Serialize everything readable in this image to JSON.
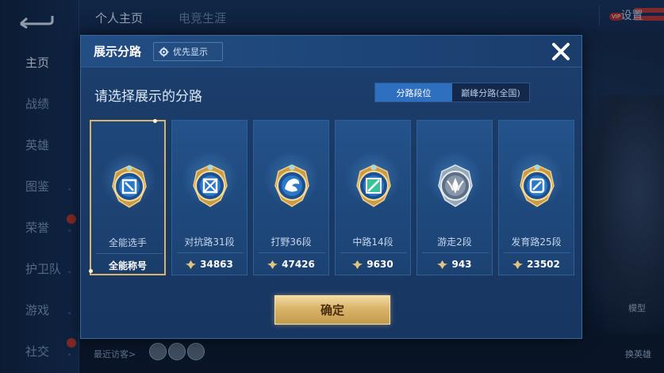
{
  "nav": {
    "items": [
      {
        "label": "主页",
        "active": true,
        "chevron": false
      },
      {
        "label": "战绩",
        "active": false,
        "chevron": false
      },
      {
        "label": "英雄",
        "active": false,
        "chevron": false
      },
      {
        "label": "图鉴",
        "active": false,
        "chevron": true
      },
      {
        "label": "荣誉",
        "active": false,
        "chevron": true
      },
      {
        "label": "护卫队",
        "active": false,
        "chevron": true
      },
      {
        "label": "游戏",
        "active": false,
        "chevron": true
      },
      {
        "label": "社交",
        "active": false,
        "chevron": true
      }
    ]
  },
  "top": {
    "tabs": [
      "个人主页",
      "电竞生涯"
    ],
    "settings_label": "设置",
    "vip_label": "VIP"
  },
  "side": {
    "model_label": "模型",
    "change_hero_label": "换英雄"
  },
  "bottom": {
    "recent_visitors": "最近访客>"
  },
  "modal": {
    "title": "展示分路",
    "priority_label": "优先显示",
    "prompt": "请选择展示的分路",
    "toggle": [
      "分路段位",
      "巅峰分路(全国)"
    ],
    "confirm_label": "确定",
    "cards": [
      {
        "label": "全能选手",
        "stat": "全能称号",
        "show_icon": false,
        "selected": true,
        "emblem": "all-round"
      },
      {
        "label": "对抗路31段",
        "stat": "34863",
        "show_icon": true,
        "selected": false,
        "emblem": "clash-lane"
      },
      {
        "label": "打野36段",
        "stat": "47426",
        "show_icon": true,
        "selected": false,
        "emblem": "jungle"
      },
      {
        "label": "中路14段",
        "stat": "9630",
        "show_icon": true,
        "selected": false,
        "emblem": "mid-lane"
      },
      {
        "label": "游走2段",
        "stat": "943",
        "show_icon": true,
        "selected": false,
        "emblem": "roam"
      },
      {
        "label": "发育路25段",
        "stat": "23502",
        "show_icon": true,
        "selected": false,
        "emblem": "farm-lane"
      }
    ]
  },
  "colors": {
    "accent_gold": "#d7b36b",
    "active_toggle": "#2f6fc0",
    "modal_bg": "#1c3f6e"
  }
}
